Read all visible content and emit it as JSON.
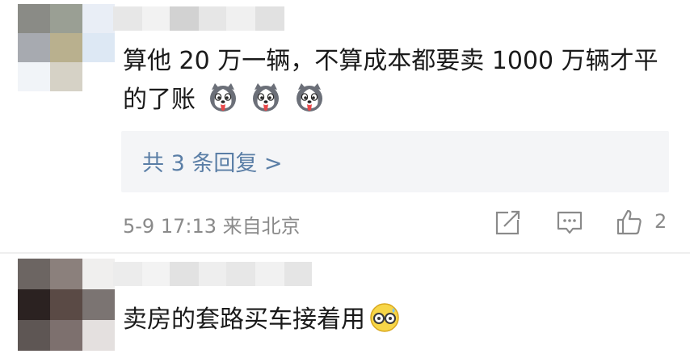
{
  "comments": [
    {
      "text": "算他 20 万一辆，不算成本都要卖 1000 万辆才平的了账",
      "emoji_icon": "husky-tongue-emoji",
      "emoji_count": 3,
      "reply_link": "共 3 条回复 >",
      "time": "5-9 17:13",
      "source": "来自北京",
      "likes": "2"
    },
    {
      "text": "卖房的套路买车接着用",
      "emoji_icon": "sweat-glasses-emoji"
    }
  ],
  "colors": {
    "reply_link": "#5a7ea6",
    "meta": "#8a8a8a",
    "reply_bg": "#f4f5f7"
  }
}
